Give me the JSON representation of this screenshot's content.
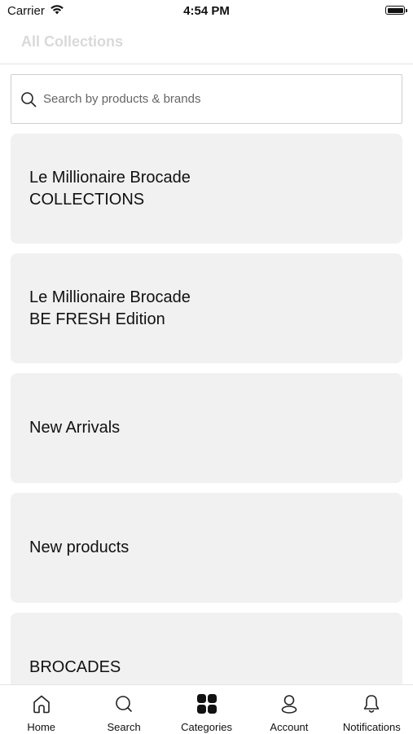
{
  "status_bar": {
    "carrier": "Carrier",
    "time": "4:54 PM"
  },
  "header": {
    "title": "All Collections"
  },
  "search": {
    "placeholder": "Search by products & brands"
  },
  "collections": [
    {
      "label": "Le Millionaire Brocade COLLECTIONS"
    },
    {
      "label": "Le Millionaire Brocade BE FRESH Edition"
    },
    {
      "label": "New Arrivals"
    },
    {
      "label": "New products"
    },
    {
      "label": "BROCADES"
    }
  ],
  "tab_bar": {
    "items": [
      {
        "label": "Home",
        "icon": "home-icon"
      },
      {
        "label": "Search",
        "icon": "search-icon"
      },
      {
        "label": "Categories",
        "icon": "categories-icon",
        "active": true
      },
      {
        "label": "Account",
        "icon": "account-icon"
      },
      {
        "label": "Notifications",
        "icon": "bell-icon"
      }
    ]
  },
  "colors": {
    "card_background": "#f1f1f1",
    "text": "#111111",
    "header_title": "#d9d9d9"
  }
}
